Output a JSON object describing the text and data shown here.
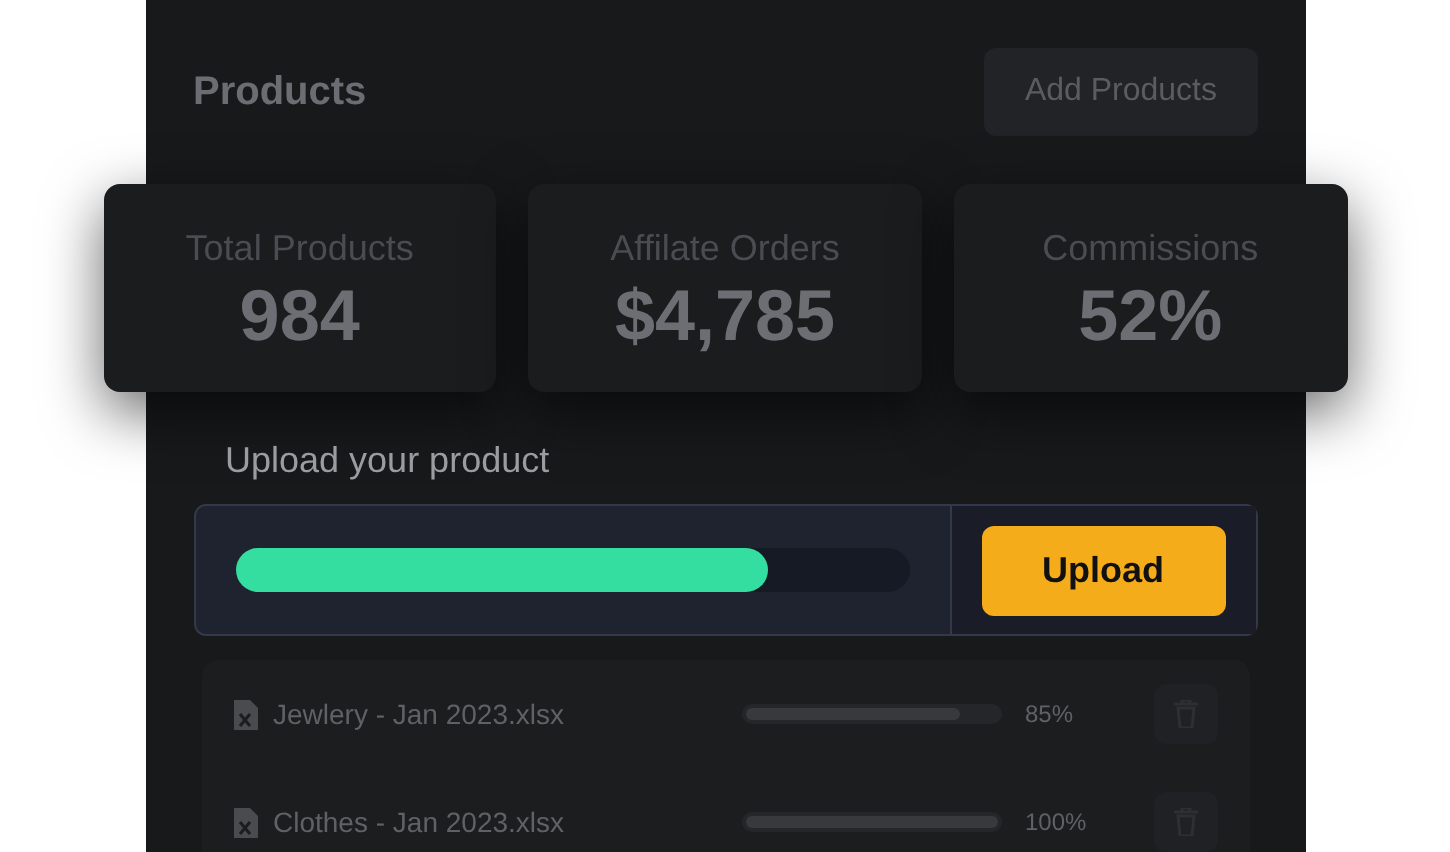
{
  "header": {
    "title": "Products",
    "button": "Add Products"
  },
  "stats": [
    {
      "label": "Total Products",
      "value": "984"
    },
    {
      "label": "Affilate Orders",
      "value": "$4,785"
    },
    {
      "label": "Commissions",
      "value": "52%"
    }
  ],
  "upload": {
    "title": "Upload your product",
    "level": 0.79,
    "button": "Upload"
  },
  "files": [
    {
      "name": "Jewlery - Jan 2023.xlsx",
      "level": 0.85,
      "reading": "85%"
    },
    {
      "name": "Clothes - Jan 2023.xlsx",
      "level": 1,
      "reading": "100%"
    }
  ]
}
